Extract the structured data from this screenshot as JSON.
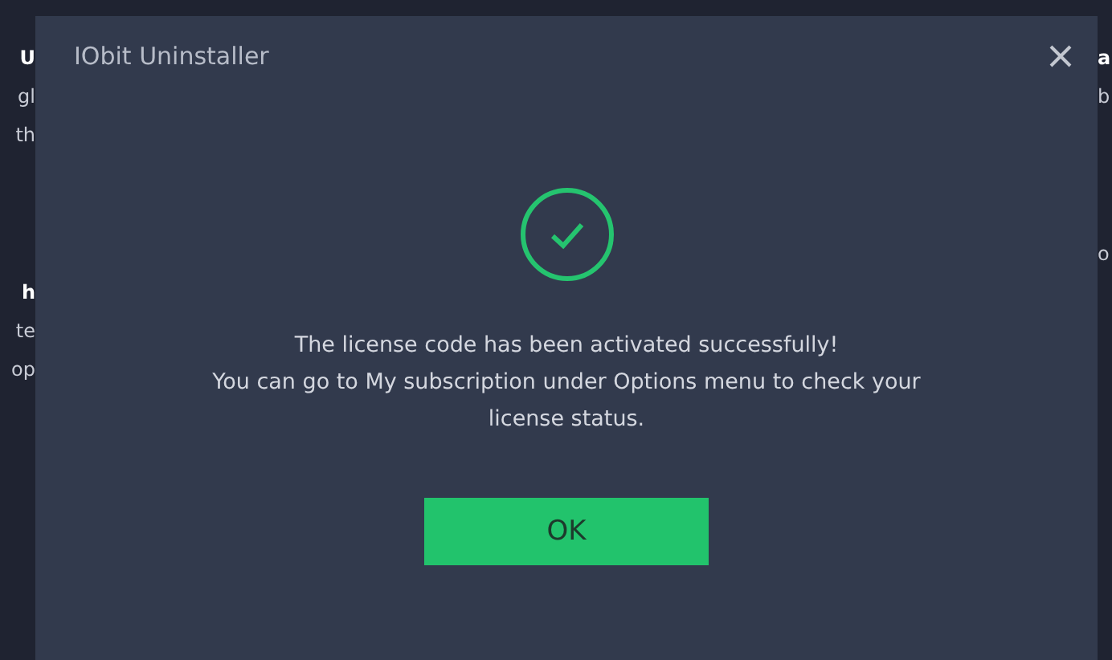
{
  "background": {
    "left_fragments": [
      "U",
      "gl",
      "th",
      "h",
      "te",
      "op"
    ],
    "right_fragments": [
      "a",
      "b",
      "o"
    ]
  },
  "dialog": {
    "title": "IObit Uninstaller",
    "message_lines": [
      "The license code has been activated successfully!",
      "You can go to My subscription under Options menu to check your",
      "license status."
    ],
    "ok_button": "OK"
  }
}
